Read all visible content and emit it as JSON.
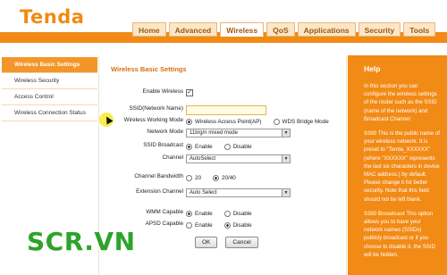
{
  "brand": {
    "logo": "Tenda",
    "accent": "#f28a16"
  },
  "nav": {
    "tabs": [
      {
        "label": "Home"
      },
      {
        "label": "Advanced"
      },
      {
        "label": "Wireless",
        "active": true
      },
      {
        "label": "QoS"
      },
      {
        "label": "Applications"
      },
      {
        "label": "Security"
      },
      {
        "label": "Tools"
      }
    ]
  },
  "sidebar": {
    "items": [
      {
        "label": "Wireless Basic Settings",
        "active": true
      },
      {
        "label": "Wireless Security"
      },
      {
        "label": "Access Control"
      },
      {
        "label": "Wireless Connection Status"
      }
    ]
  },
  "form": {
    "title": "Wireless Basic Settings",
    "enable_wireless": {
      "label": "Enable Wireless",
      "checked": true
    },
    "ssid": {
      "label": "SSID(Network Name)",
      "value": ""
    },
    "working_mode": {
      "label": "Wireless Working Mode",
      "options": [
        "Wireless Access Point(AP)",
        "WDS Bridge Mode"
      ],
      "selected": "Wireless Access Point(AP)"
    },
    "network_mode": {
      "label": "Network Mode",
      "value": "11b/g/n mixed mode"
    },
    "ssid_broadcast": {
      "label": "SSID Broadcast",
      "options": [
        "Enable",
        "Disable"
      ],
      "selected": "Enable"
    },
    "channel": {
      "label": "Channel",
      "value": "AutoSelect"
    },
    "channel_bandwidth": {
      "label": "Channel Bandwidth",
      "options": [
        "20",
        "20/40"
      ],
      "selected": "20/40"
    },
    "extension_channel": {
      "label": "Extension Channel",
      "value": "Auto Select"
    },
    "wmm": {
      "label": "WMM Capable",
      "options": [
        "Enable",
        "Disable"
      ],
      "selected": "Enable"
    },
    "apsd": {
      "label": "APSD Capable",
      "options": [
        "Enable",
        "Disable"
      ],
      "selected": "Disable"
    },
    "ok_label": "OK",
    "cancel_label": "Cancel"
  },
  "help": {
    "title": "Help",
    "intro": "In this section you can configure the wireless settings of the router such as the SSID (name of the network) and Broadcast Channel",
    "ssid_head": "SSID",
    "ssid_text": "This is the public name of your wireless network. It is preset to \"Tenda_XXXXXX\" (where \"XXXXXX\" represents the last six characters in device MAC address.) by default. Please change it for better security. Note that this field should not be left blank.",
    "broadcast_head": "SSID Broadcast",
    "broadcast_text": "This option allows you to have your network names (SSIDs) publicly broadcast or if you choose to disable it, the SSID will be hidden."
  },
  "watermark": "SCR.VN"
}
